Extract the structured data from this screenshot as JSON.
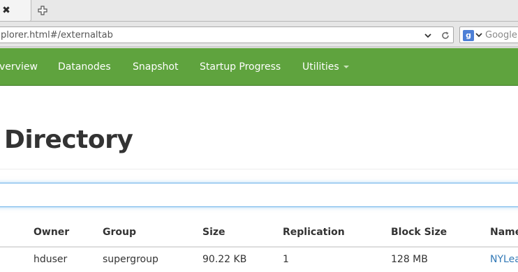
{
  "browser": {
    "tab_close_glyph": "✖",
    "url": "plorer.html#/externaltab",
    "search_placeholder": "Google"
  },
  "nav": {
    "items": [
      {
        "label": "verview"
      },
      {
        "label": "Datanodes"
      },
      {
        "label": "Snapshot"
      },
      {
        "label": "Startup Progress"
      },
      {
        "label": "Utilities"
      }
    ],
    "accent": "#5fa33e"
  },
  "page": {
    "title": "e Directory"
  },
  "table": {
    "columns": [
      "Owner",
      "Group",
      "Size",
      "Replication",
      "Block Size",
      "Name"
    ],
    "rows": [
      {
        "owner": "hduser",
        "group": "supergroup",
        "size": "90.22 KB",
        "replication": "1",
        "block_size": "128 MB",
        "name": "NYLea"
      }
    ]
  }
}
